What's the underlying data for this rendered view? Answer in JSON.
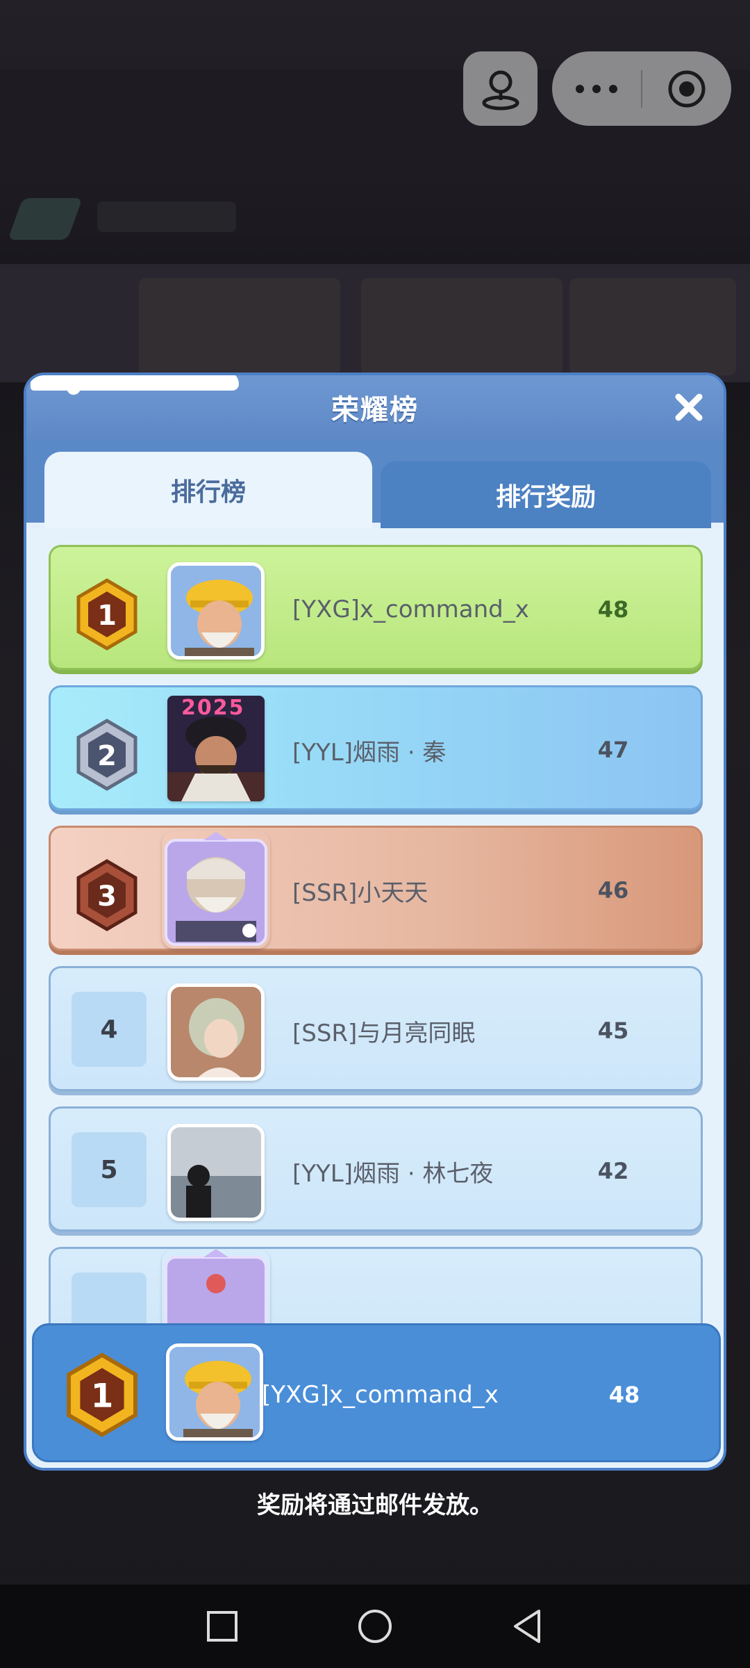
{
  "top_controls": {
    "icons": [
      "pin-icon",
      "more-icon",
      "record-icon"
    ]
  },
  "modal": {
    "title": "荣耀榜",
    "tabs": [
      {
        "label": "排行榜",
        "active": true
      },
      {
        "label": "排行奖励",
        "active": false
      }
    ],
    "rows": [
      {
        "rank": "1",
        "name": "[YXG]x_command_x",
        "score": "48",
        "tier": "gold"
      },
      {
        "rank": "2",
        "name": "[YYL]烟雨 · 秦",
        "score": "47",
        "tier": "silver",
        "avatar_text": "2025"
      },
      {
        "rank": "3",
        "name": "[SSR]小天天",
        "score": "46",
        "tier": "bronze"
      },
      {
        "rank": "4",
        "name": "[SSR]与月亮同眠",
        "score": "45",
        "tier": "plain"
      },
      {
        "rank": "5",
        "name": "[YYL]烟雨 · 林七夜",
        "score": "42",
        "tier": "plain"
      }
    ],
    "my_rank": {
      "rank": "1",
      "name": "[YXG]x_command_x",
      "score": "48"
    }
  },
  "footer_note": "奖励将通过邮件发放。",
  "colors": {
    "header_blue": "#6e98d2",
    "gold_row": "#c4ee8d",
    "silver_row": "#98dbf7",
    "bronze_row": "#e6b7a0",
    "plain_row": "#d3e9fb",
    "my_bar": "#4a8ed8"
  }
}
